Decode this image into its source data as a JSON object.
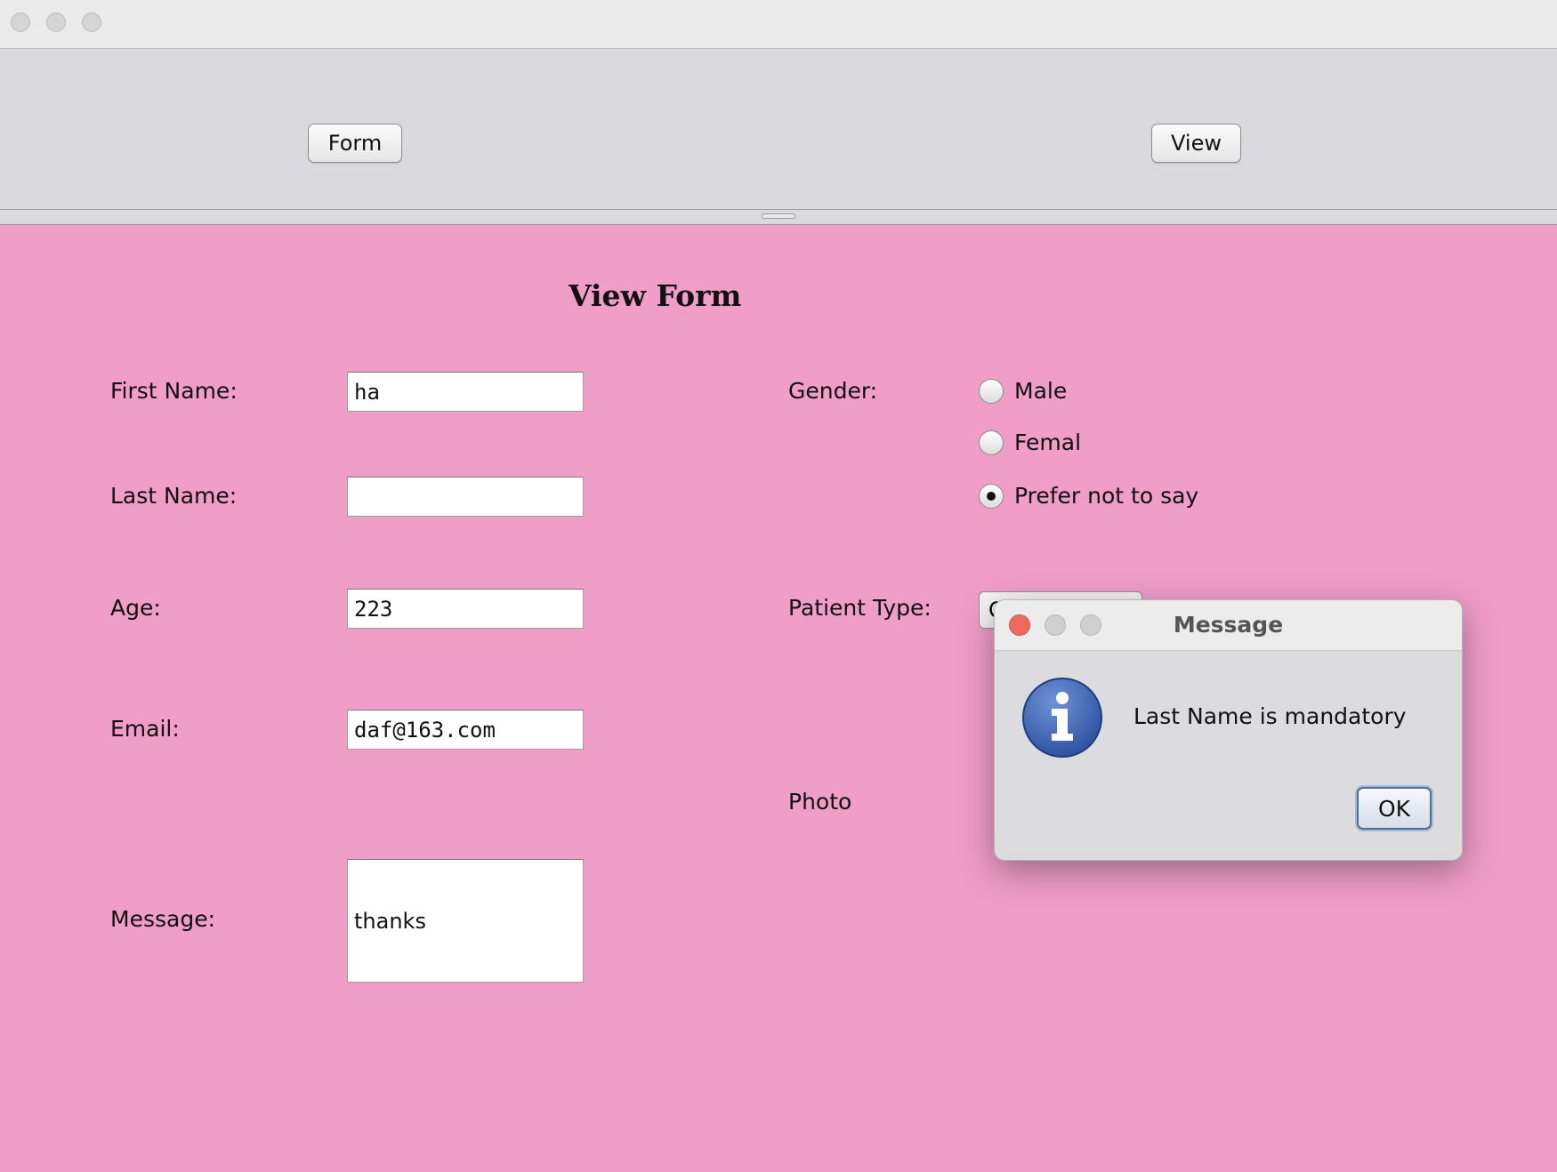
{
  "toolbar": {
    "form_label": "Form",
    "view_label": "View"
  },
  "form": {
    "heading": "View Form",
    "first_name": {
      "label": "First Name:",
      "value": "ha"
    },
    "last_name": {
      "label": "Last Name:",
      "value": ""
    },
    "age": {
      "label": "Age:",
      "value": "223"
    },
    "email": {
      "label": "Email:",
      "value": "daf@163.com"
    },
    "message": {
      "label": "Message:",
      "value": "thanks"
    },
    "gender": {
      "label": "Gender:",
      "options": [
        "Male",
        "Femal",
        "Prefer not to say"
      ],
      "selected": "Prefer not to say"
    },
    "patient_type": {
      "label": "Patient Type:",
      "value": "O"
    },
    "photo_label": "Photo"
  },
  "dialog": {
    "title": "Message",
    "message": "Last Name is mandatory",
    "ok_label": "OK",
    "icon": "info-icon"
  },
  "colors": {
    "background": "#f09dc8",
    "panel": "#d9d9de",
    "dialog_icon": "#3a5fae",
    "close_red": "#ec6a5e"
  }
}
